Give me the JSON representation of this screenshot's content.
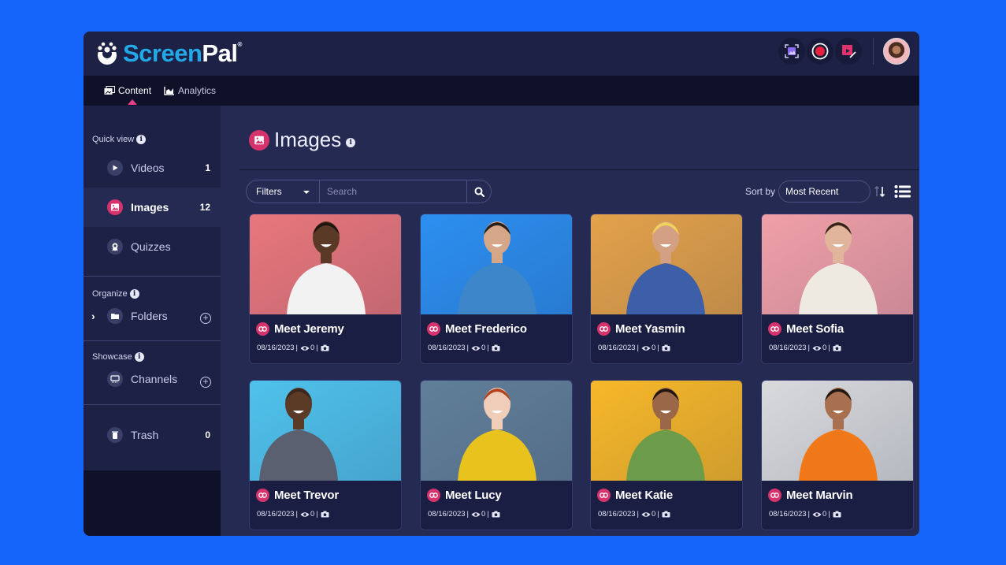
{
  "app": {
    "brand_part1": "Screen",
    "brand_part2": "Pal",
    "brand_mark": "®"
  },
  "header": {
    "actions": [
      {
        "name": "screenshot",
        "icon": "screenshot-icon"
      },
      {
        "name": "record",
        "icon": "record-icon"
      },
      {
        "name": "video-editor",
        "icon": "video-editor-icon"
      }
    ],
    "avatar": "user-avatar"
  },
  "nav": {
    "tabs": [
      {
        "label": "Content",
        "icon": "content-icon",
        "active": true
      },
      {
        "label": "Analytics",
        "icon": "analytics-icon",
        "active": false
      }
    ]
  },
  "sidebar": {
    "quick_view_label": "Quick view",
    "quick_view": [
      {
        "label": "Videos",
        "count": "1",
        "icon": "play-icon"
      },
      {
        "label": "Images",
        "count": "12",
        "icon": "image-icon",
        "active": true
      },
      {
        "label": "Quizzes",
        "count": "",
        "icon": "quiz-icon"
      }
    ],
    "organize_label": "Organize",
    "folders_label": "Folders",
    "showcase_label": "Showcase",
    "channels_label": "Channels",
    "trash_label": "Trash",
    "trash_count": "0"
  },
  "main": {
    "title": "Images",
    "filters_label": "Filters",
    "search_placeholder": "Search",
    "search_value": "",
    "sort_label": "Sort by",
    "sort_value": "Most Recent",
    "colors": {
      "accent": "#d6336c",
      "brand_blue": "#22a9e8",
      "background": "#252a52"
    }
  },
  "cards": [
    {
      "title": "Meet Jeremy",
      "date": "08/16/2023",
      "views": "0",
      "bg": "#e8777c",
      "shirt": "#f2f2f2",
      "skin": "#5a3a26",
      "hair": "#1f1510"
    },
    {
      "title": "Meet Frederico",
      "date": "08/16/2023",
      "views": "0",
      "bg": "#2c8ff0",
      "shirt": "#3d86c9",
      "skin": "#d6a688",
      "hair": "#2b1e17"
    },
    {
      "title": "Meet Yasmin",
      "date": "08/16/2023",
      "views": "0",
      "bg": "#e3a24a",
      "shirt": "#3d5fa8",
      "skin": "#d4a083",
      "hair": "#f2d35a"
    },
    {
      "title": "Meet Sofia",
      "date": "08/16/2023",
      "views": "0",
      "bg": "#f0a0a8",
      "shirt": "#eeeae2",
      "skin": "#e0b59c",
      "hair": "#3a231a"
    },
    {
      "title": "Meet Trevor",
      "date": "08/16/2023",
      "views": "0",
      "bg": "#4fc2ec",
      "shirt": "#5a6070",
      "skin": "#5b3a26",
      "hair": "#3a261a"
    },
    {
      "title": "Meet Lucy",
      "date": "08/16/2023",
      "views": "0",
      "bg": "#617f99",
      "shirt": "#e8c21d",
      "skin": "#f0cdb8",
      "hair": "#b3411d"
    },
    {
      "title": "Meet Katie",
      "date": "08/16/2023",
      "views": "0",
      "bg": "#f7b829",
      "shirt": "#6c9b4a",
      "skin": "#9a6848",
      "hair": "#201510"
    },
    {
      "title": "Meet Marvin",
      "date": "08/16/2023",
      "views": "0",
      "bg": "#d8dadc",
      "shirt": "#f07818",
      "skin": "#a87050",
      "hair": "#221712"
    }
  ]
}
